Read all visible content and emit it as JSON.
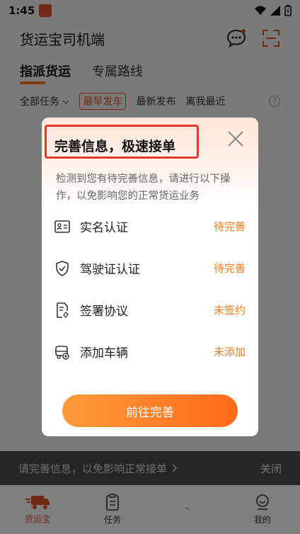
{
  "status_bar": {
    "time": "1:45"
  },
  "header": {
    "title": "货运宝司机端"
  },
  "main_tabs": [
    {
      "label": "指派货运"
    },
    {
      "label": "专属路线"
    }
  ],
  "filters": [
    {
      "label": "全部任务"
    },
    {
      "label": "最早发车"
    },
    {
      "label": "最新发布"
    },
    {
      "label": "离我最近"
    }
  ],
  "help_symbol": "?",
  "modal": {
    "title": "完善信息，极速接单",
    "description": "检测到您有待完善信息，请进行以下操作，以免影响您的正常货运业务",
    "items": [
      {
        "label": "实名认证",
        "status": "待完善",
        "icon": "id-card-icon"
      },
      {
        "label": "驾驶证认证",
        "status": "待完善",
        "icon": "shield-check-icon"
      },
      {
        "label": "签署协议",
        "status": "未签约",
        "icon": "document-sign-icon"
      },
      {
        "label": "添加车辆",
        "status": "未添加",
        "icon": "vehicle-add-icon"
      }
    ],
    "cta_label": "前往完善"
  },
  "notice_bar": {
    "text": "请完善信息，以免影响正常接单",
    "close_label": "关闭"
  },
  "bottom_nav": [
    {
      "label": "货运宝"
    },
    {
      "label": "任务"
    },
    {
      "label": ""
    },
    {
      "label": "我的"
    }
  ],
  "colors": {
    "accent": "#ff7a1a",
    "highlight_border": "#e23a2a",
    "overlay": "rgba(0,0,0,0.5)"
  }
}
